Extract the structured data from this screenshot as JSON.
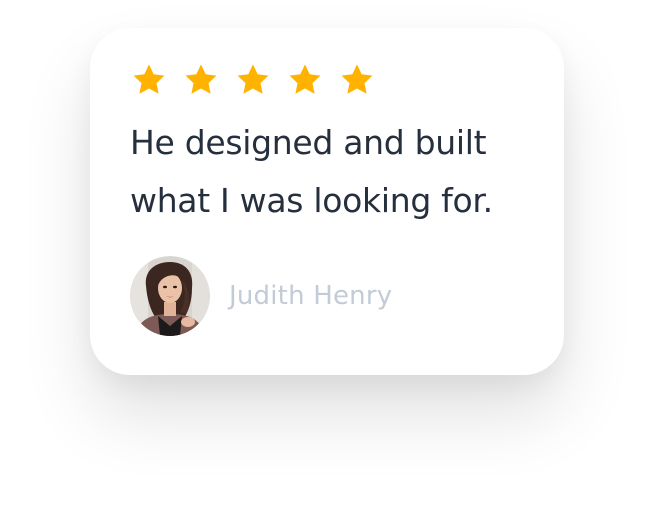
{
  "testimonial": {
    "rating": 5,
    "rating_max": 5,
    "quote": "He designed and built what I was looking for.",
    "author_name": "Judith Henry",
    "star_color": "#FFB300",
    "quote_color": "#262F3D",
    "author_color": "#C3CBD7"
  },
  "icons": {
    "star": "star-icon",
    "avatar": "avatar-photo"
  }
}
